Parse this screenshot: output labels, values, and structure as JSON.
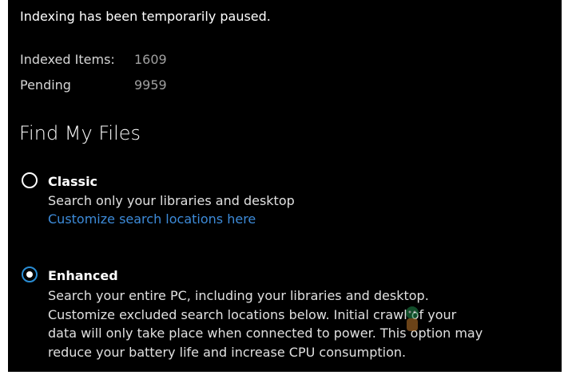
{
  "status": {
    "message": "Indexing has been temporarily paused.",
    "indexed_items_label": "Indexed Items:",
    "indexed_items_value": "1609",
    "pending_label": "Pending",
    "pending_value": "9959"
  },
  "find_my_files": {
    "title": "Find My Files",
    "options": [
      {
        "label": "Classic",
        "selected": false,
        "description_lines": [
          "Search only your libraries and desktop"
        ],
        "link": "Customize search locations here"
      },
      {
        "label": "Enhanced",
        "selected": true,
        "description_lines": [
          "Search your entire PC, including your libraries and desktop.",
          "Customize excluded search locations below. Initial crawl of your",
          "data will only take place when connected to power. This option may",
          "reduce your battery life and increase CPU consumption."
        ]
      }
    ]
  },
  "colors": {
    "background": "#000000",
    "accent": "#2a8dd4",
    "link": "#3d8bd9"
  }
}
